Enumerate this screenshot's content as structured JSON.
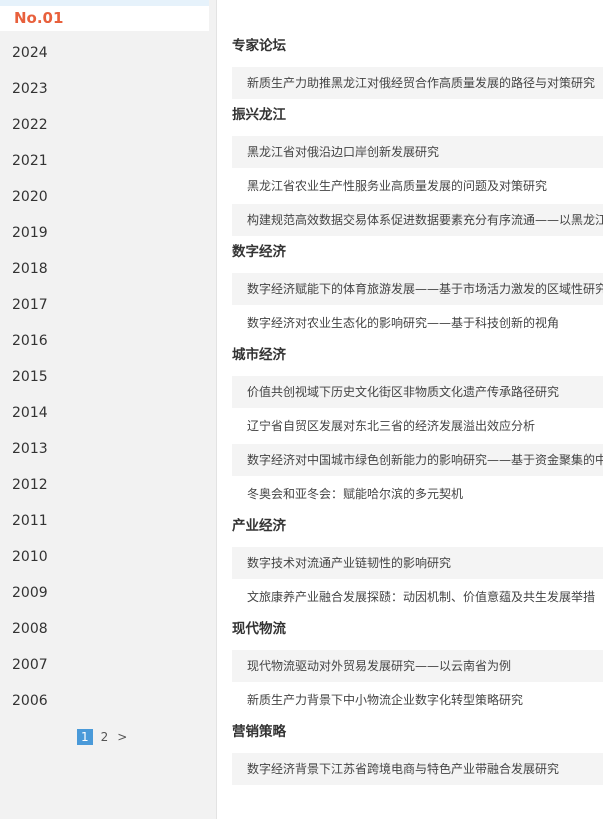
{
  "sidebar": {
    "current_issue": "No.01",
    "years": [
      "2024",
      "2023",
      "2022",
      "2021",
      "2020",
      "2019",
      "2018",
      "2017",
      "2016",
      "2015",
      "2014",
      "2013",
      "2012",
      "2011",
      "2010",
      "2009",
      "2008",
      "2007",
      "2006"
    ],
    "pager": {
      "pages": [
        "1",
        "2"
      ],
      "active": "1",
      "next": ">"
    }
  },
  "main": {
    "sections": [
      {
        "title": "专家论坛",
        "articles": [
          "新质生产力助推黑龙江对俄经贸合作高质量发展的路径与对策研究"
        ]
      },
      {
        "title": "振兴龙江",
        "articles": [
          "黑龙江省对俄沿边口岸创新发展研究",
          "黑龙江省农业生产性服务业高质量发展的问题及对策研究",
          "构建规范高效数据交易体系促进数据要素充分有序流通——以黑龙江"
        ]
      },
      {
        "title": "数字经济",
        "articles": [
          "数字经济赋能下的体育旅游发展——基于市场活力激发的区域性研究",
          "数字经济对农业生态化的影响研究——基于科技创新的视角"
        ]
      },
      {
        "title": "城市经济",
        "articles": [
          "价值共创视域下历史文化街区非物质文化遗产传承路径研究",
          "辽宁省自贸区发展对东北三省的经济发展溢出效应分析",
          "数字经济对中国城市绿色创新能力的影响研究——基于资金聚集的中",
          "冬奥会和亚冬会：赋能哈尔滨的多元契机"
        ]
      },
      {
        "title": "产业经济",
        "articles": [
          "数字技术对流通产业链韧性的影响研究",
          "文旅康养产业融合发展探赜：动因机制、价值意蕴及共生发展举措"
        ]
      },
      {
        "title": "现代物流",
        "articles": [
          "现代物流驱动对外贸易发展研究——以云南省为例",
          "新质生产力背景下中小物流企业数字化转型策略研究"
        ]
      },
      {
        "title": "营销策略",
        "articles": [
          "数字经济背景下江苏省跨境电商与特色产业带融合发展研究"
        ]
      }
    ]
  }
}
